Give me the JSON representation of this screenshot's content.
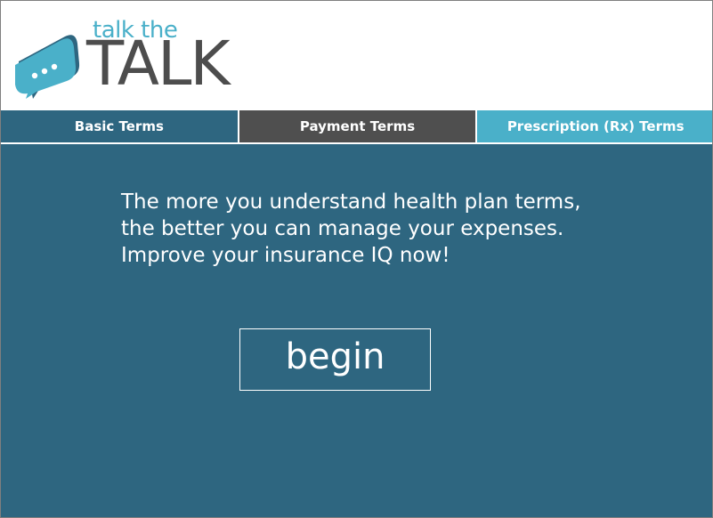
{
  "logo": {
    "small_text": "talk the",
    "big_text": "TALK",
    "icon": "speech-bubble-icon"
  },
  "tabs": [
    {
      "label": "Basic Terms",
      "color": "#2e6680"
    },
    {
      "label": "Payment Terms",
      "color": "#4f4f4f"
    },
    {
      "label": "Prescription (Rx) Terms",
      "color": "#4ab0c9"
    }
  ],
  "main": {
    "intro_text": "The more you understand health plan terms, the better you can manage your expenses. Improve your insurance IQ now!",
    "begin_label": "begin"
  },
  "colors": {
    "primary": "#2e6680",
    "accent": "#4ab0c9",
    "dark": "#4f4f4f"
  }
}
